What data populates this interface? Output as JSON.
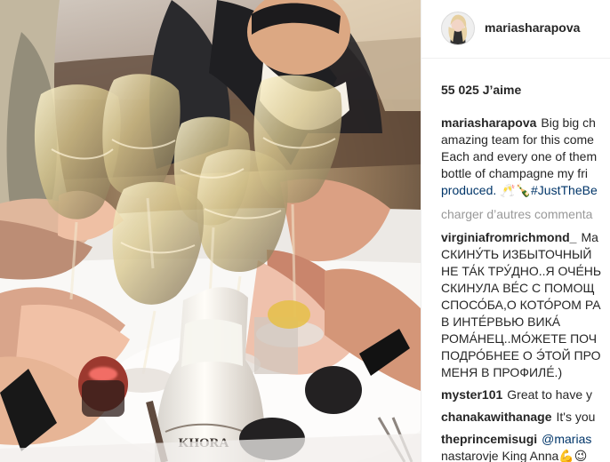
{
  "post": {
    "author": "mariasharapova",
    "likes": "55 025 J’aime",
    "caption_lines": [
      "Big big ch",
      "amazing team for this come",
      "Each and every one of them",
      "bottle of champagne my fri",
      "produced. 🥂🍾#JustTheBe"
    ],
    "load_more": "charger d’autres commenta",
    "comments": [
      {
        "user": "virginiafromrichmond_",
        "lines": [
          "Ma",
          "СКИНУ́ТЬ ИЗБЫТОЧНЫЙ",
          "НЕ ТА́К ТРУ́ДНО..Я ОЧЕ́НЬ",
          "СКИНУЛА ВЕ́С С ПОМОЩ",
          "СПОСО́БА,О КОТО́РОМ РА",
          "В ИНТЕ́РВЬЮ ВИКА́",
          "РОМА́НЕЦ..МО́ЖЕТЕ ПОЧ",
          "ПОДРО́БНЕЕ О Э́ТОЙ ПРО",
          "МЕНЯ В ПРОФИЛЕ́.)"
        ]
      },
      {
        "user": "myster101",
        "text": "Great to have y"
      },
      {
        "user": "chanakawithanage",
        "text": "It's you"
      },
      {
        "user": "theprincemisugi",
        "mention": "@marias",
        "text2": "nastarovje King Anna💪😉"
      }
    ]
  },
  "photo": {
    "bottle_label": "KHORA"
  }
}
